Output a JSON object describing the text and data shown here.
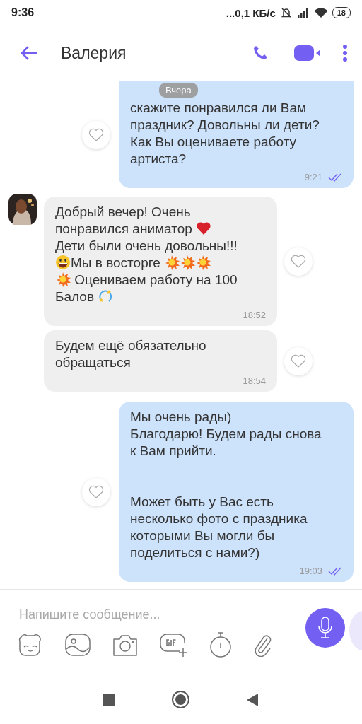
{
  "status_bar": {
    "time": "9:36",
    "speed": "...0,1 КБ/с",
    "battery": "18"
  },
  "header": {
    "title": "Валерия"
  },
  "date_badge": "Вчера",
  "messages": [
    {
      "kind": "outgoing",
      "time": "9:21",
      "read": true,
      "body": [
        {
          "kind": "text",
          "text": "скажите понравился ли Вам\nпраздник? Довольны ли дети?\nКак Вы оцениваете работу\nартиста?"
        }
      ]
    },
    {
      "kind": "incoming",
      "avatar": true,
      "time": "18:52",
      "body": [
        {
          "kind": "text",
          "text": "Добрый вечер! Очень"
        },
        {
          "kind": "break"
        },
        {
          "kind": "text",
          "text": "понравился аниматор "
        },
        {
          "kind": "heart"
        },
        {
          "kind": "break"
        },
        {
          "kind": "text",
          "text": "Дети были очень довольны!!!"
        },
        {
          "kind": "break"
        },
        {
          "kind": "grin"
        },
        {
          "kind": "text",
          "text": "Мы в восторге "
        },
        {
          "kind": "burst"
        },
        {
          "kind": "burst"
        },
        {
          "kind": "burst"
        },
        {
          "kind": "break"
        },
        {
          "kind": "burst"
        },
        {
          "kind": "text",
          "text": " Оцениваем работу на 100"
        },
        {
          "kind": "break"
        },
        {
          "kind": "text",
          "text": "Балов "
        },
        {
          "kind": "dizzy"
        }
      ]
    },
    {
      "kind": "incoming",
      "avatar": false,
      "time": "18:54",
      "body": [
        {
          "kind": "text",
          "text": "Будем ещё обязательно\nобращаться"
        }
      ]
    },
    {
      "kind": "outgoing",
      "time": "19:03",
      "read": true,
      "body": [
        {
          "kind": "text",
          "text": "Мы очень рады)\nБлагодарю! Будем рады снова\nк Вам прийти.\n\nМожет быть у Вас есть\nнесколько фото с праздника\nкоторыми Вы могли бы\nподелиться с нами?)"
        }
      ]
    }
  ],
  "composer": {
    "placeholder": "Напишите сообщение..."
  }
}
